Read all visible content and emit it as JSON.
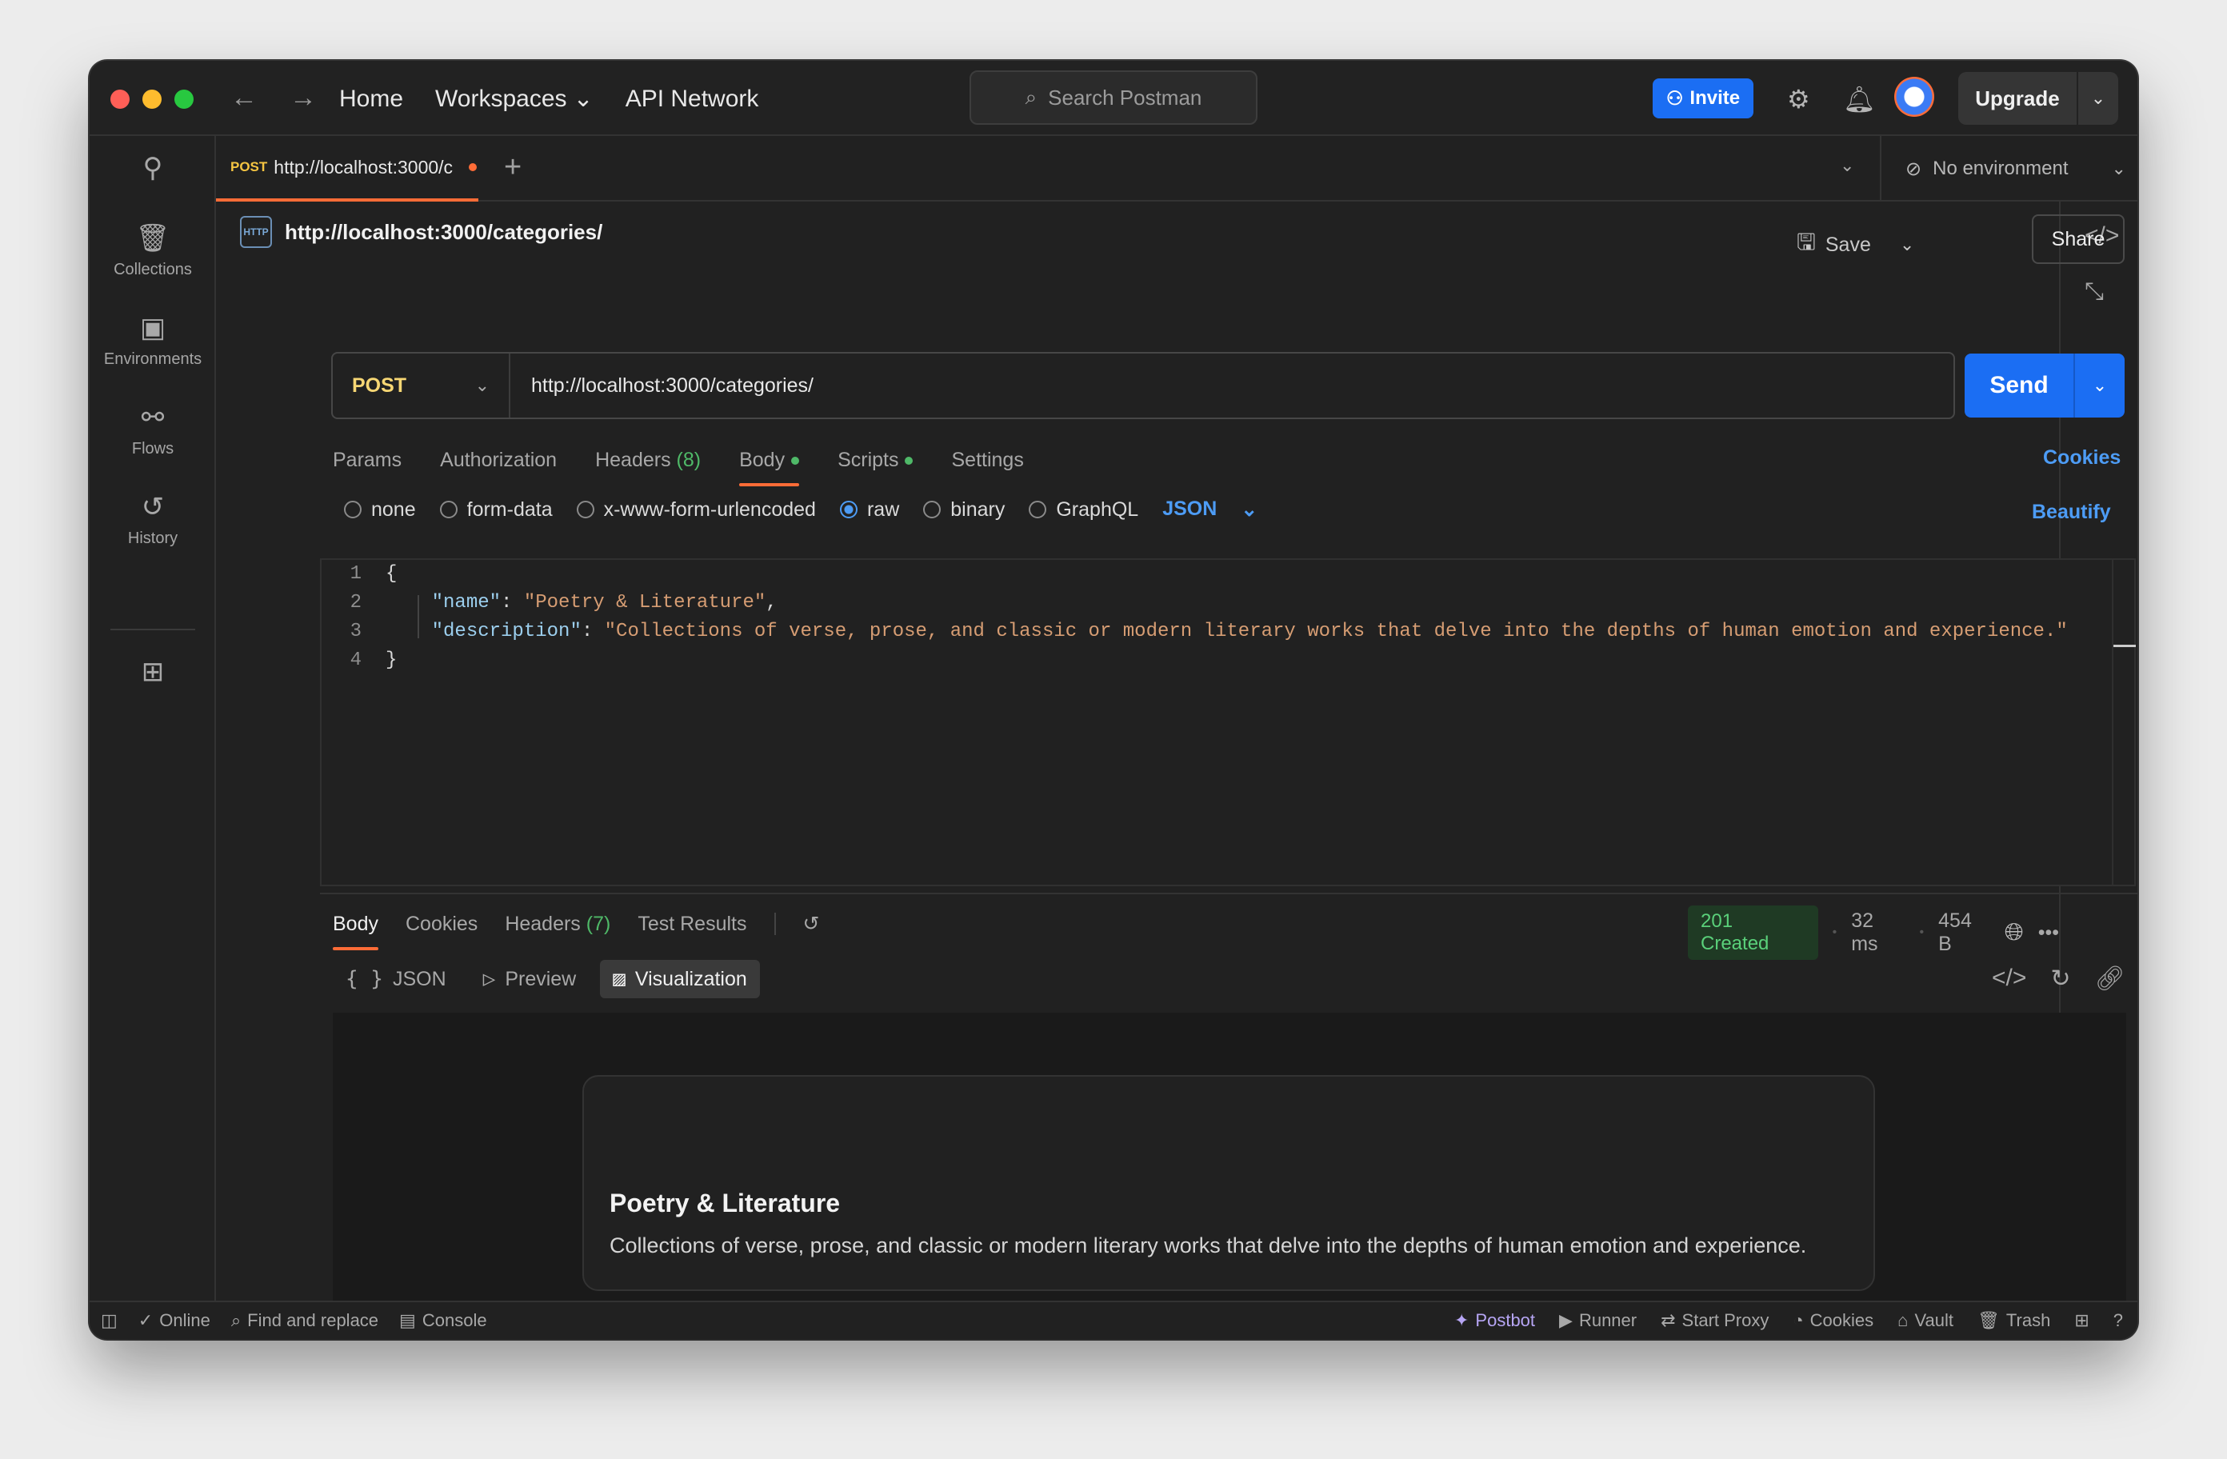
{
  "titlebar": {
    "nav": {
      "back": "←",
      "forward": "→"
    },
    "links": {
      "home": "Home",
      "workspaces": "Workspaces",
      "api_network": "API Network"
    },
    "search_placeholder": "Search Postman",
    "invite_label": "Invite",
    "upgrade_label": "Upgrade"
  },
  "sidebar": {
    "items": [
      {
        "label": "Collections",
        "icon": "collections-icon"
      },
      {
        "label": "Environments",
        "icon": "environments-icon"
      },
      {
        "label": "Flows",
        "icon": "flows-icon"
      },
      {
        "label": "History",
        "icon": "history-icon"
      }
    ]
  },
  "tabbar": {
    "active_tab": {
      "method": "POST",
      "url": "http://localhost:3000/c"
    },
    "environment": "No environment"
  },
  "request": {
    "title": "http://localhost:3000/categories/",
    "save_label": "Save",
    "share_label": "Share",
    "method": "POST",
    "url": "http://localhost:3000/categories/",
    "send_label": "Send",
    "tabs": {
      "params": "Params",
      "authorization": "Authorization",
      "headers": "Headers",
      "headers_count": "(8)",
      "body": "Body",
      "scripts": "Scripts",
      "settings": "Settings"
    },
    "cookies_label": "Cookies",
    "body_modes": {
      "none": "none",
      "form_data": "form-data",
      "urlencoded": "x-www-form-urlencoded",
      "raw": "raw",
      "binary": "binary",
      "graphql": "GraphQL"
    },
    "body_format": "JSON",
    "beautify_label": "Beautify",
    "code": {
      "line_numbers": [
        "1",
        "2",
        "3",
        "4"
      ],
      "open_brace": "{",
      "name_key": "\"name\"",
      "name_value": "\"Poetry & Literature\"",
      "desc_key": "\"description\"",
      "desc_value": "\"Collections of verse, prose, and classic or modern literary works that delve into the depths of human emotion and experience.\"",
      "close_brace": "}"
    }
  },
  "response": {
    "tabs": {
      "body": "Body",
      "cookies": "Cookies",
      "headers": "Headers",
      "headers_count": "(7)",
      "test_results": "Test Results"
    },
    "status": "201 Created",
    "time": "32 ms",
    "size": "454 B",
    "views": {
      "json": "JSON",
      "preview": "Preview",
      "visualization": "Visualization"
    },
    "card": {
      "title": "Poetry & Literature",
      "description": "Collections of verse, prose, and classic or modern literary works that delve into the depths of human emotion and experience."
    }
  },
  "statusbar": {
    "online": "Online",
    "find_replace": "Find and replace",
    "console": "Console",
    "postbot": "Postbot",
    "runner": "Runner",
    "start_proxy": "Start Proxy",
    "cookies": "Cookies",
    "vault": "Vault",
    "trash": "Trash"
  },
  "colors": {
    "accent": "#ff6c37",
    "primary": "#1b6ef3",
    "link": "#4d9cf5",
    "success": "#5ad07a"
  }
}
